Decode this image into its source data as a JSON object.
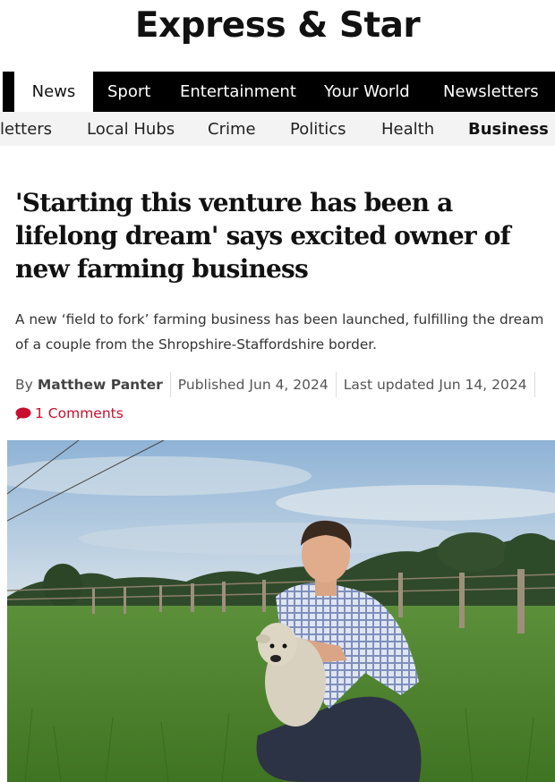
{
  "site": {
    "logo": "Express & Star"
  },
  "nav": {
    "primary": [
      "News",
      "Sport",
      "Entertainment",
      "Your World",
      "Newsletters"
    ],
    "secondary": [
      "letters",
      "Local Hubs",
      "Crime",
      "Politics",
      "Health",
      "Business"
    ]
  },
  "article": {
    "headline": "'Starting this venture has been a lifelong dream' says excited owner of new farming business",
    "standfirst": "A new ‘field to fork’ farming business has been launched, fulfilling the dream of a couple from the Shropshire-Staffordshire border.",
    "byline": {
      "by": "By",
      "author": "Matthew Panter",
      "published_label": "Published",
      "published": "Jun 4, 2024",
      "updated_label": "Last updated",
      "updated": "Jun 14, 2024"
    },
    "comments": "1 Comments"
  },
  "colors": {
    "accent": "#c8102e",
    "nav_bg": "#000000",
    "subnav_bg": "#f3f3f3"
  },
  "icons": {
    "comments": "speech-bubble-icon"
  }
}
